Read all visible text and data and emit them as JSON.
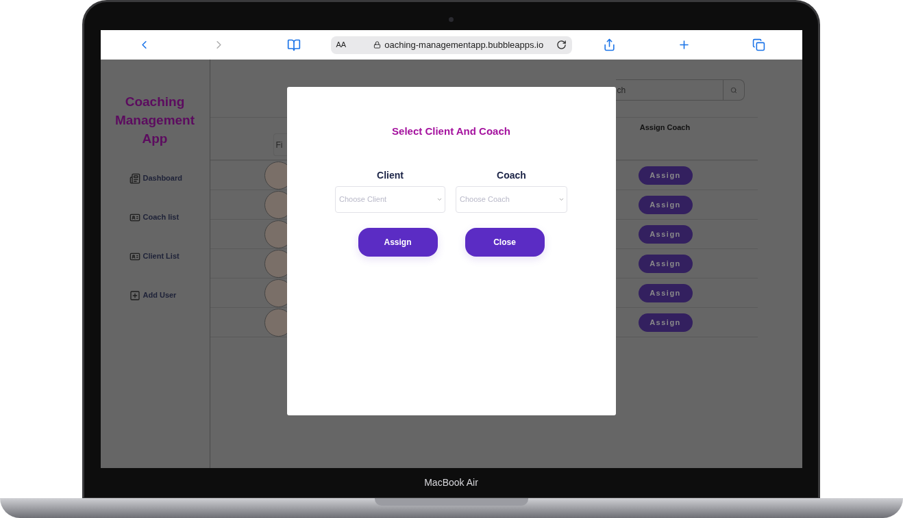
{
  "device": {
    "label": "MacBook Air"
  },
  "browser": {
    "text_size": "AA",
    "url": "oaching-managementapp.bubbleapps.io"
  },
  "sidebar": {
    "title": "Coaching Management App",
    "items": [
      {
        "label": "Dashboard",
        "kind": "dashboard"
      },
      {
        "label": "Coach list",
        "kind": "card"
      },
      {
        "label": "Client List",
        "kind": "card"
      },
      {
        "label": "Add User",
        "kind": "add"
      }
    ]
  },
  "main": {
    "search": {
      "placeholder": "ch"
    },
    "filter": {
      "placeholder": "Fi"
    },
    "columns": [
      "Assign Coach"
    ],
    "rows": [
      {
        "action": "Assign"
      },
      {
        "action": "Assign"
      },
      {
        "action": "Assign"
      },
      {
        "action": "Assign"
      },
      {
        "action": "Assign"
      },
      {
        "action": "Assign"
      }
    ]
  },
  "modal": {
    "title": "Select Client And Coach",
    "fields": [
      {
        "label": "Client",
        "placeholder": "Choose Client"
      },
      {
        "label": "Coach",
        "placeholder": "Choose Coach"
      }
    ],
    "buttons": [
      "Assign",
      "Close"
    ]
  }
}
